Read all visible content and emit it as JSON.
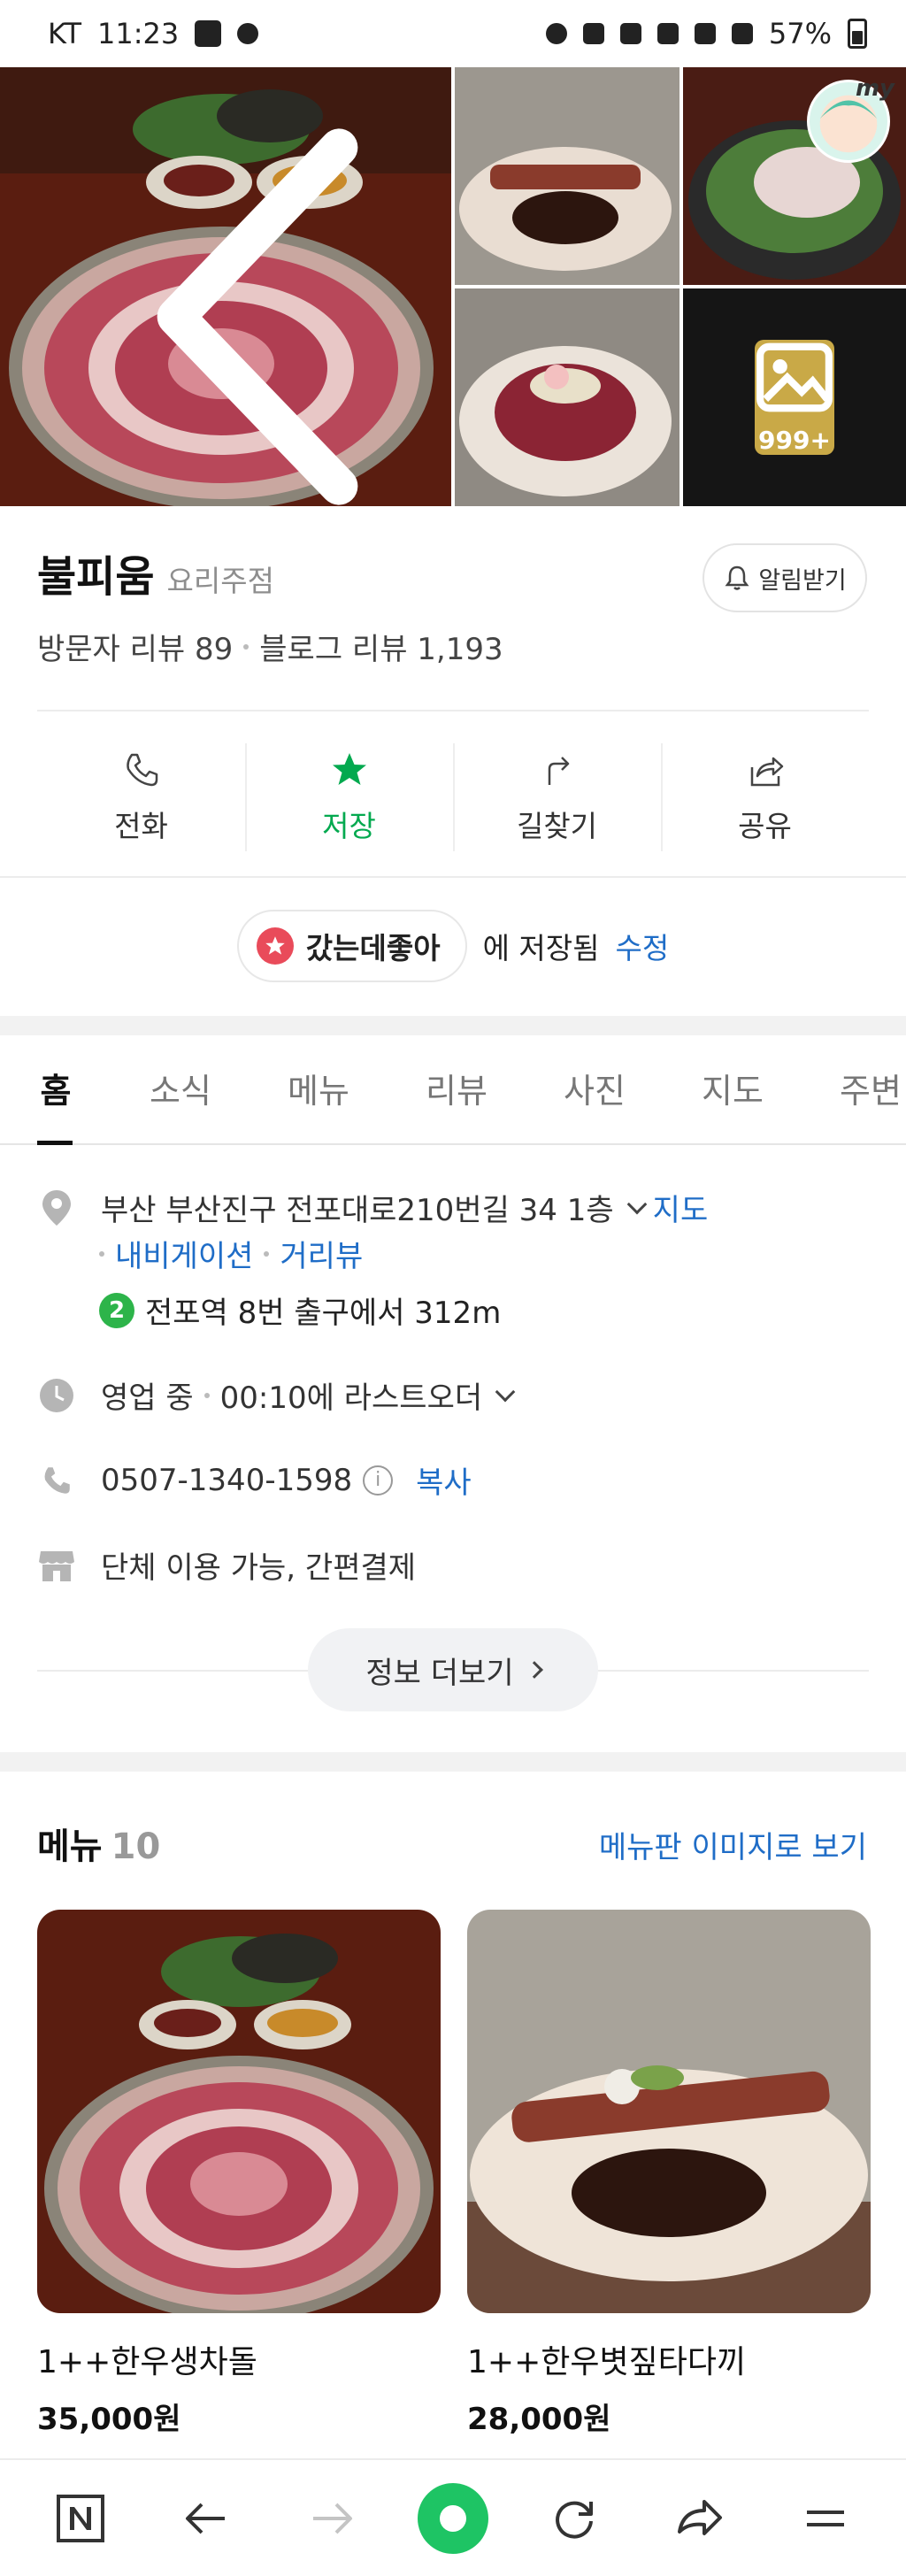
{
  "status": {
    "carrier": "KT",
    "time": "11:23",
    "battery": "57%"
  },
  "photos": {
    "more_count": "999+"
  },
  "place": {
    "name": "불피움",
    "category": "요리주점",
    "alarm_label": "알림받기",
    "visitor_reviews_label": "방문자 리뷰 89",
    "blog_reviews_label": "블로그 리뷰 1,193"
  },
  "actions": [
    {
      "label": "전화",
      "icon": "phone-icon"
    },
    {
      "label": "저장",
      "icon": "star-icon",
      "active": true
    },
    {
      "label": "길찾기",
      "icon": "directions-icon"
    },
    {
      "label": "공유",
      "icon": "share-icon"
    }
  ],
  "saved": {
    "list_name": "갔는데좋아",
    "suffix": "에 저장됨",
    "edit_label": "수정"
  },
  "tabs": [
    "홈",
    "소식",
    "메뉴",
    "리뷰",
    "사진",
    "지도",
    "주변"
  ],
  "details": {
    "address": "부산 부산진구 전포대로210번길 34 1층",
    "map_link": "지도",
    "navigation_link": "내비게이션",
    "street_view_link": "거리뷰",
    "subway_line": "2",
    "subway_text": "전포역 8번 출구에서 312m",
    "hours_status": "영업 중",
    "hours_detail": "00:10에 라스트오더",
    "phone": "0507-1340-1598",
    "copy_label": "복사",
    "amenities": "단체 이용 가능, 간편결제",
    "more_info_label": "정보 더보기"
  },
  "menu": {
    "title": "메뉴",
    "count": "10",
    "board_link": "메뉴판 이미지로 보기",
    "items": [
      {
        "name": "1++한우생차돌",
        "price": "35,000원"
      },
      {
        "name": "1++한우볏짚타다끼",
        "price": "28,000원"
      }
    ]
  },
  "colors": {
    "accent_green": "#03a94f",
    "link_blue": "#1f6dc7",
    "chip_red": "#e94b5a",
    "subway_green": "#2db44a"
  }
}
